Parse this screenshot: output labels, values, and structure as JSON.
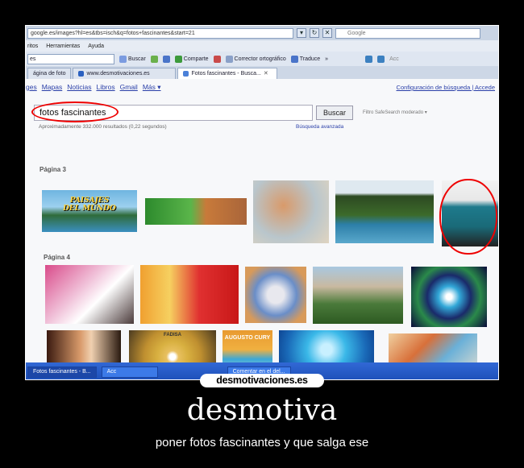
{
  "browser": {
    "address": "google.es/images?hl=es&tbs=isch&q=fotos+fascinantes&start=21",
    "search_box": "Google",
    "menu": [
      "ritos",
      "Herramientas",
      "Ayuda"
    ],
    "toolbar": {
      "search_value": "es",
      "buscar": "Buscar",
      "comparte": "Comparte",
      "corrector": "Corrector ortográfico",
      "traduce": "Traduce",
      "more": "»",
      "extra": "Acc"
    },
    "tabs": [
      {
        "label": "ágina de foto",
        "active": false
      },
      {
        "label": "www.desmotivaciones.es",
        "active": false
      },
      {
        "label": "Fotos fascinantes - Busca...",
        "active": true
      }
    ]
  },
  "google": {
    "nav": [
      "ges",
      "Mapas",
      "Noticias",
      "Libros",
      "Gmail",
      "Más ▾"
    ],
    "config": "Configuración de búsqueda | Accede",
    "query": "fotos fascinantes",
    "search_button": "Buscar",
    "safe_search": "Filtro SafeSearch moderado ▾",
    "results": "Aproximadamente 332.000 resultados (0,22 segundos)",
    "advanced": "Búsqueda avanzada",
    "page3_label": "Página 3",
    "page4_label": "Página 4",
    "thumb_caption": "PAISAJES DEL MUNDO",
    "cd_title": "FADISA",
    "book_title": "AUGUSTO CURY"
  },
  "taskbar": {
    "items": [
      "Fotos fascinantes - B...",
      "Acc",
      "Comentar en el del..."
    ]
  },
  "poster": {
    "logo": "desmotivaciones.es",
    "title": "desmotiva",
    "subtitle": "poner fotos fascinantes y que salga ese"
  }
}
